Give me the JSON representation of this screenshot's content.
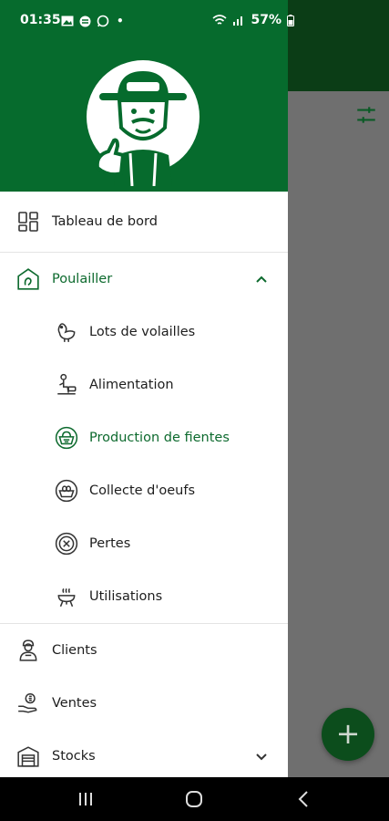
{
  "status_bar": {
    "time": "01:35",
    "dot": "•",
    "battery": "57%",
    "icons": [
      "image-icon",
      "circle-app-icon",
      "whatsapp-icon",
      "wifi-icon",
      "signal-icon",
      "battery-icon"
    ]
  },
  "drawer": {
    "header_color": "#066b2d",
    "items": {
      "dashboard": "Tableau de bord",
      "poultry": "Poulailler",
      "poultry_sub": {
        "lots": "Lots de volailles",
        "feeding": "Alimentation",
        "droppings": "Production de fientes",
        "eggs": "Collecte d'oeufs",
        "losses": "Pertes",
        "usages": "Utilisations"
      },
      "clients": "Clients",
      "sales": "Ventes",
      "stocks": "Stocks"
    },
    "active_item": "Production de fientes",
    "accent": "#0d6a2e"
  },
  "fab": {
    "label": "+",
    "color": "#0c4d1c"
  }
}
